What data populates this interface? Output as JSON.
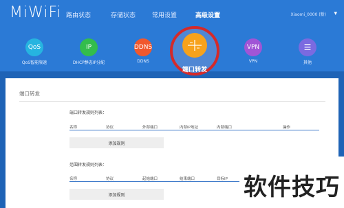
{
  "header": {
    "logo": "MiWiFi",
    "nav": [
      "路由状态",
      "存储状态",
      "常用设置",
      "高级设置"
    ],
    "active_nav": "高级设置",
    "device": "Xiaomi_0000 (新)"
  },
  "icons": [
    {
      "glyph": "QoS",
      "label": "QoS智能限速",
      "color": "#26b4e0"
    },
    {
      "glyph": "IP",
      "label": "DHCP静态IP分配",
      "color": "#33bd4c"
    },
    {
      "glyph": "DDNS",
      "label": "DDNS",
      "color": "#f0582e"
    },
    {
      "glyph": "",
      "label": "端口转发",
      "color": "#f7a21c"
    },
    {
      "glyph": "VPN",
      "label": "VPN",
      "color": "#a055d6"
    },
    {
      "glyph": "☰",
      "label": "其他",
      "color": "#7b6ae0"
    }
  ],
  "section": {
    "title": "端口转发",
    "port_rules": {
      "label": "端口转发规则列表：",
      "columns": [
        "名称",
        "协议",
        "外部端口",
        "内部IP地址",
        "内部端口",
        "操作"
      ],
      "add_button": "添加规则"
    },
    "range_rules": {
      "label": "范围转发规则列表：",
      "columns": [
        "名称",
        "协议",
        "起始端口",
        "结束端口",
        "目标IP"
      ],
      "add_button": "添加规则"
    }
  },
  "watermark": "软件技巧"
}
